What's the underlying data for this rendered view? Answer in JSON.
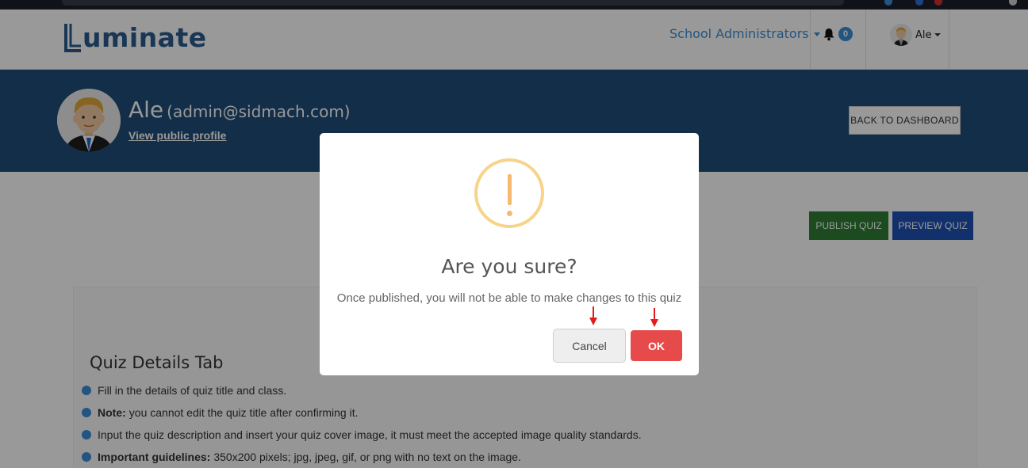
{
  "brand": {
    "logo_text": "uminate",
    "logo_color": "#2a5d8c"
  },
  "navbar": {
    "role_label": "School Administrators",
    "notification_count": "0",
    "user_name": "Ale"
  },
  "profile": {
    "name": "Ale",
    "email": "(admin@sidmach.com)",
    "view_profile_link": "View public profile",
    "back_button": "BACK TO DASHBOARD"
  },
  "actions": {
    "publish_button": "PUBLISH QUIZ",
    "preview_button": "PREVIEW QUIZ"
  },
  "guide": {
    "title": "Quiz Details Tab",
    "items": [
      {
        "bold": "",
        "text": "Fill in the details of quiz title and class."
      },
      {
        "bold": "Note:",
        "text": "you cannot edit the quiz title after confirming it."
      },
      {
        "bold": "",
        "text": "Input the quiz description and insert your quiz cover image, it must meet the accepted image quality standards."
      },
      {
        "bold": "Important guidelines:",
        "text": "350x200 pixels; jpg, jpeg, gif, or png with no text on the image."
      }
    ]
  },
  "dialog": {
    "icon": "warning-icon",
    "title": "Are you sure?",
    "message": "Once published, you will not be able to make changes to this quiz",
    "cancel_label": "Cancel",
    "ok_label": "OK"
  },
  "colors": {
    "banner": "#1f4e79",
    "accent": "#3b8ed6",
    "publish": "#2e7d32",
    "preview": "#1e53b4",
    "ok": "#e64a4a",
    "warning": "#f8d38a"
  }
}
